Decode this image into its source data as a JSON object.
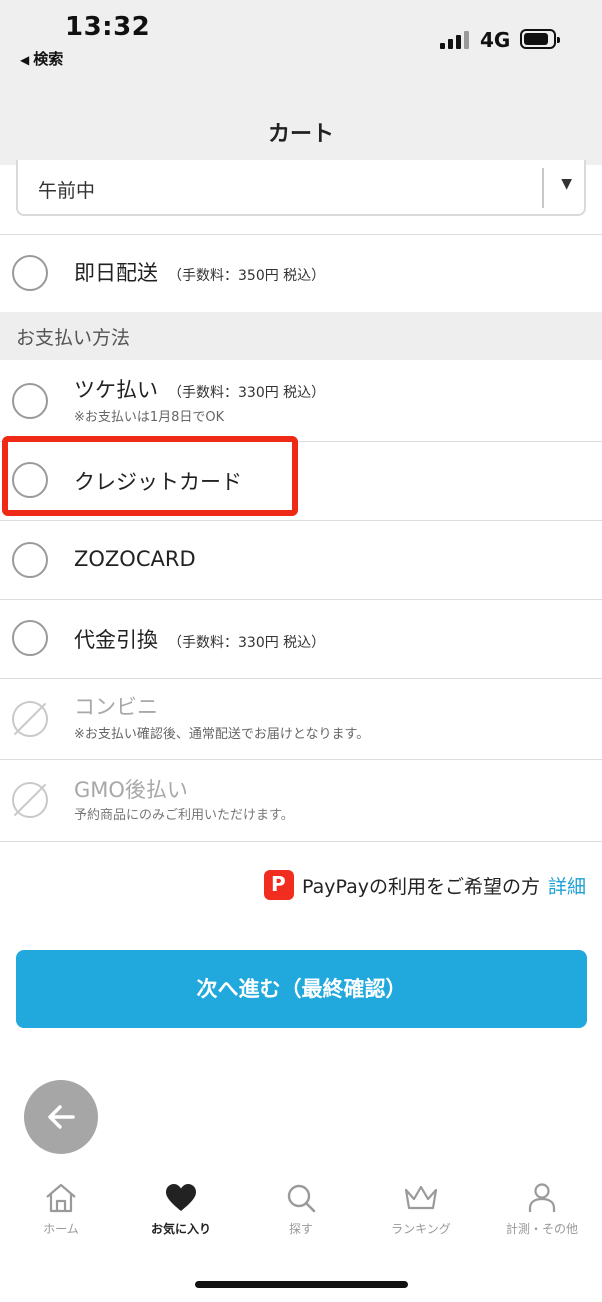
{
  "status_bar": {
    "time": "13:32",
    "back_app": "検索",
    "network": "4G"
  },
  "header": {
    "title": "カート"
  },
  "delivery_time": {
    "value": "午前中"
  },
  "same_day": {
    "label": "即日配送",
    "fee": "（手数料：350円 税込）"
  },
  "payment": {
    "section_title": "お支払い方法",
    "options": [
      {
        "label": "ツケ払い",
        "fee": "（手数料：330円 税込）",
        "note": "※お支払いは1月8日でOK",
        "enabled": true,
        "selected": false
      },
      {
        "label": "クレジットカード",
        "fee": "",
        "note": "",
        "enabled": true,
        "selected": false,
        "highlighted": true
      },
      {
        "label": "ZOZOCARD",
        "fee": "",
        "note": "",
        "enabled": true,
        "selected": false
      },
      {
        "label": "代金引換",
        "fee": "（手数料：330円 税込）",
        "note": "",
        "enabled": true,
        "selected": false
      },
      {
        "label": "コンビニ",
        "fee": "",
        "note": "※お支払い確認後、通常配送でお届けとなります。",
        "enabled": false,
        "selected": false
      },
      {
        "label": "GMO後払い",
        "fee": "",
        "note": "予約商品にのみご利用いただけます。",
        "enabled": false,
        "selected": false
      }
    ]
  },
  "paypay": {
    "text": "PayPayの利用をご希望の方",
    "link": "詳細",
    "icon": "paypay-icon"
  },
  "next_button": {
    "label": "次へ進む（最終確認）"
  },
  "tabbar": {
    "items": [
      {
        "label": "ホーム",
        "icon": "home-icon",
        "active": false
      },
      {
        "label": "お気に入り",
        "icon": "heart-icon",
        "active": true
      },
      {
        "label": "探す",
        "icon": "search-icon",
        "active": false
      },
      {
        "label": "ランキング",
        "icon": "crown-icon",
        "active": false
      },
      {
        "label": "計測・その他",
        "icon": "person-icon",
        "active": false
      }
    ]
  },
  "colors": {
    "accent": "#21a9dd",
    "highlight": "#ee2a17",
    "paypay": "#f02d1f"
  }
}
